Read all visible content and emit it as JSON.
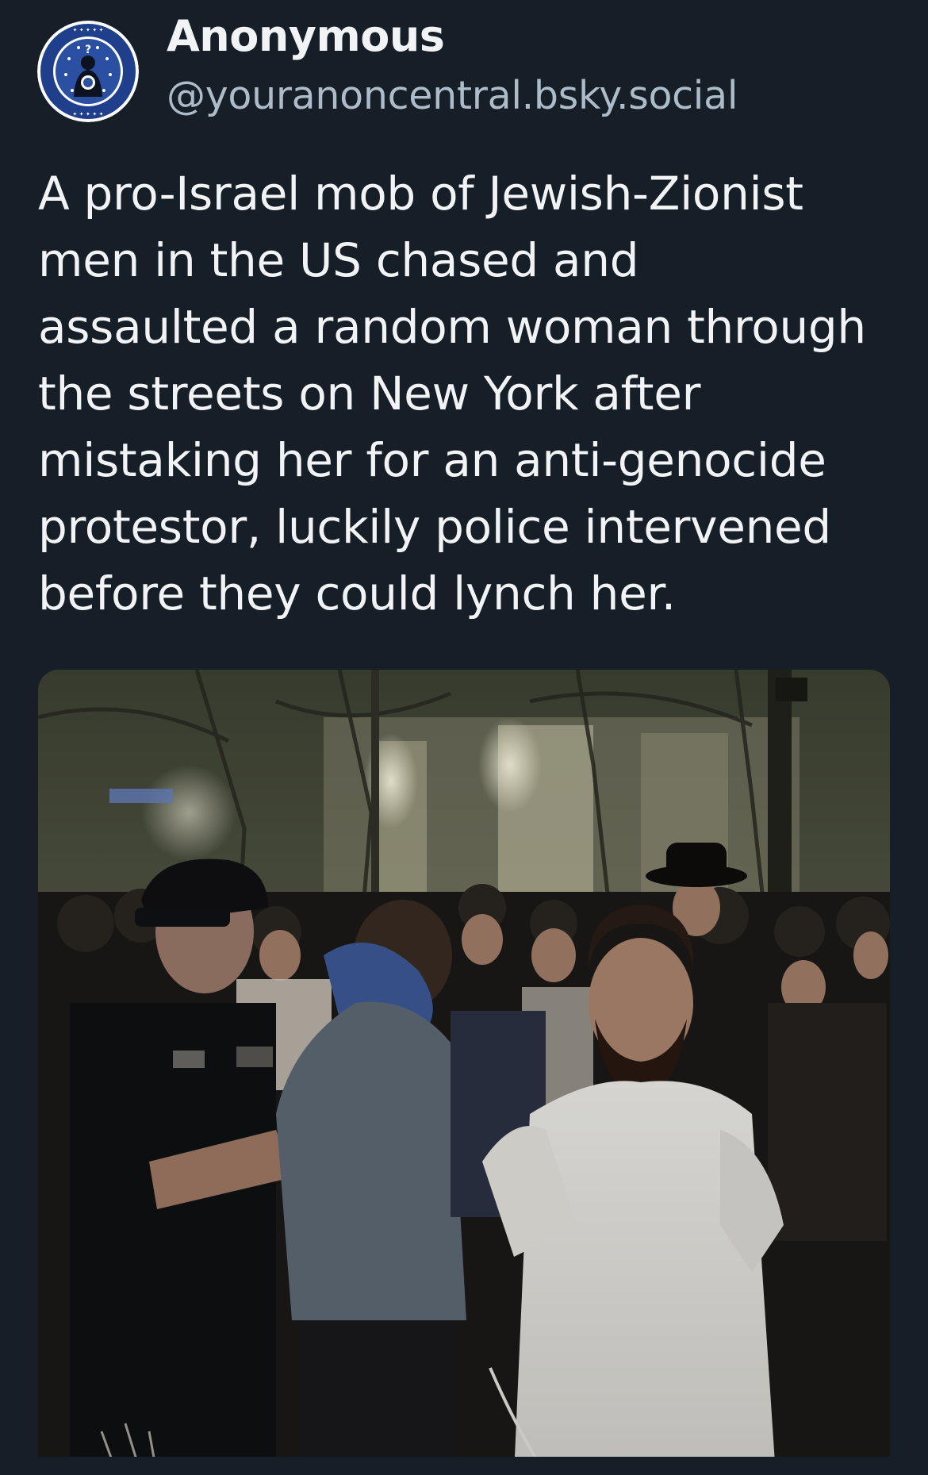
{
  "post": {
    "author": {
      "display_name": "Anonymous",
      "handle": "@youranoncentral.bsky.social"
    },
    "text_lines": [
      "A pro-Israel mob of Jewish-Zionist",
      "men in the US chased and",
      "assaulted a random woman through",
      "the streets on New York after",
      "mistaking her for an anti-genocide",
      "protestor, luckily police intervened",
      "before they could lynch her."
    ],
    "media": {
      "type": "video-still"
    }
  },
  "theme": {
    "background": "#161e27",
    "text_primary": "#f1f3f5",
    "text_secondary": "#aebbc9",
    "avatar_ring": "#1e3f8f"
  }
}
